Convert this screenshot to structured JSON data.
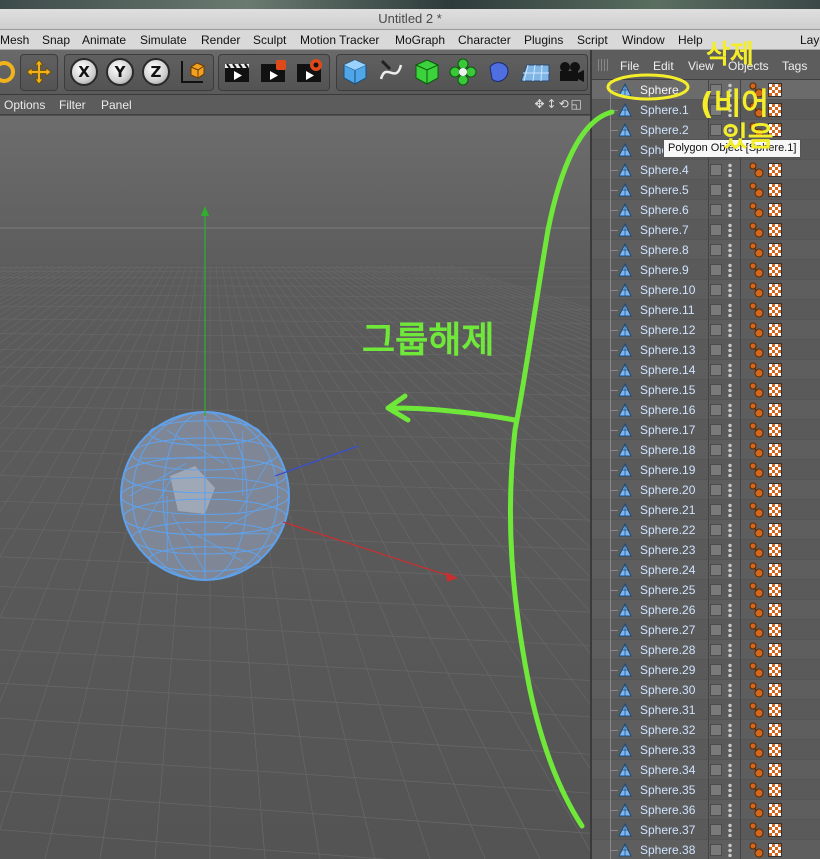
{
  "window": {
    "title": "Untitled 2 *"
  },
  "menu": [
    "Mesh",
    "Snap",
    "Animate",
    "Simulate",
    "Render",
    "Sculpt",
    "Motion Tracker",
    "MoGraph",
    "Character",
    "Plugins",
    "Script",
    "Window",
    "Help",
    "Layo"
  ],
  "toolbar": {
    "axis_x": "X",
    "axis_y": "Y",
    "axis_z": "Z",
    "icons": [
      "undo-icon",
      "move-icon",
      "x-axis-lock",
      "y-axis-lock",
      "z-axis-lock",
      "coordinate-system-icon",
      "render-view-icon",
      "render-picture-viewer-icon",
      "render-settings-icon",
      "cube-primitive-icon",
      "spline-pen-icon",
      "subdivision-icon",
      "cloner-icon",
      "deformer-icon",
      "floor-icon",
      "camera-icon"
    ]
  },
  "viewport_menu": {
    "options": "Options",
    "filter": "Filter",
    "panel": "Panel"
  },
  "object_manager": {
    "menu": {
      "file": "File",
      "edit": "Edit",
      "view": "View",
      "objects": "Objects",
      "tags": "Tags"
    },
    "objects": [
      "Sphere",
      "Sphere.1",
      "Sphere.2",
      "Sphere.3",
      "Sphere.4",
      "Sphere.5",
      "Sphere.6",
      "Sphere.7",
      "Sphere.8",
      "Sphere.9",
      "Sphere.10",
      "Sphere.11",
      "Sphere.12",
      "Sphere.13",
      "Sphere.14",
      "Sphere.15",
      "Sphere.16",
      "Sphere.17",
      "Sphere.18",
      "Sphere.19",
      "Sphere.20",
      "Sphere.21",
      "Sphere.22",
      "Sphere.23",
      "Sphere.24",
      "Sphere.25",
      "Sphere.26",
      "Sphere.27",
      "Sphere.28",
      "Sphere.29",
      "Sphere.30",
      "Sphere.31",
      "Sphere.32",
      "Sphere.33",
      "Sphere.34",
      "Sphere.35",
      "Sphere.36",
      "Sphere.37",
      "Sphere.38"
    ]
  },
  "tooltip": "Polygon Object [Sphere.1]",
  "annotations": {
    "group_release": "그룹해제",
    "delete_note_1": "삭제",
    "delete_note_2": "(비어",
    "delete_note_3": "있음",
    "color": "#6fe83a",
    "color_yellow": "#f4ee2a"
  },
  "colors": {
    "accent_blue": "#7db6f0",
    "texture_orange": "#d0661f",
    "axis_x": "#c83030",
    "axis_y": "#2eb02e",
    "axis_z": "#3a4fd0"
  }
}
